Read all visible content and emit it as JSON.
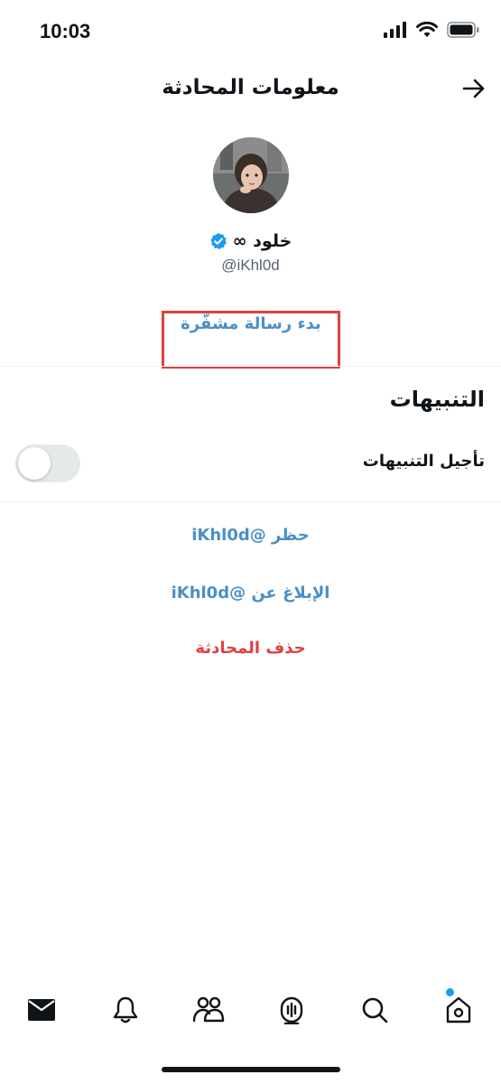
{
  "status_bar": {
    "time": "10:03"
  },
  "header": {
    "title": "معلومات المحادثة"
  },
  "profile": {
    "display_name": "خلود ∞",
    "handle": "@iKhl0d",
    "verified": true
  },
  "encrypted_message_link": "بدء رسالة مشفّرة",
  "notifications": {
    "section_title": "التنبيهات",
    "snooze_label": "تأجيل التنبيهات",
    "snooze_enabled": false
  },
  "actions": {
    "block": "حظر @iKhl0d",
    "report": "الإبلاغ عن @iKhl0d",
    "delete": "حذف المحادثة"
  },
  "tab_bar": {
    "items": [
      "mail-icon",
      "bell-icon",
      "communities-icon",
      "spaces-icon",
      "search-icon",
      "home-icon"
    ],
    "home_has_notification_dot": true
  },
  "colors": {
    "link_blue": "#4a90c8",
    "danger_red": "#e0413f",
    "highlight_border": "#e0413f",
    "verified_blue": "#1d9bf0"
  }
}
